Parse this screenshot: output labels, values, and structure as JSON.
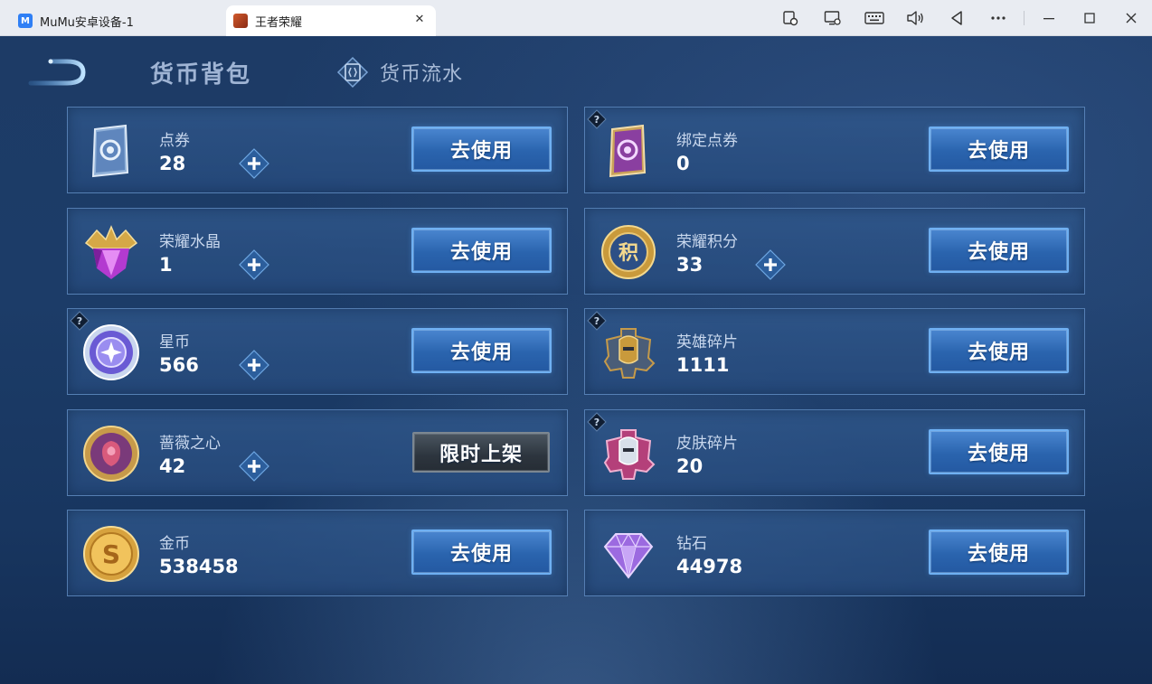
{
  "window": {
    "tabs": [
      {
        "label": "MuMu安卓设备-1",
        "logo": "M"
      },
      {
        "label": "王者荣耀"
      }
    ]
  },
  "toolbar_icons": [
    "settings-monitor-icon",
    "screen-record-icon",
    "keyboard-icon",
    "volume-icon",
    "back-nav-icon",
    "more-icon",
    "minimize-icon",
    "maximize-icon",
    "close-icon"
  ],
  "header": {
    "title": "货币背包",
    "flow_tab": "货币流水"
  },
  "currencies": [
    {
      "name": "点券",
      "value": "28",
      "button": "去使用",
      "add": true,
      "help": false,
      "icon": "voucher-card-icon"
    },
    {
      "name": "绑定点券",
      "value": "0",
      "button": "去使用",
      "add": false,
      "help": true,
      "icon": "bound-voucher-card-icon"
    },
    {
      "name": "荣耀水晶",
      "value": "1",
      "button": "去使用",
      "add": true,
      "help": false,
      "icon": "glory-crystal-icon"
    },
    {
      "name": "荣耀积分",
      "value": "33",
      "button": "去使用",
      "add": true,
      "help": false,
      "icon": "glory-points-icon"
    },
    {
      "name": "星币",
      "value": "566",
      "button": "去使用",
      "add": true,
      "help": true,
      "icon": "star-coin-icon"
    },
    {
      "name": "英雄碎片",
      "value": "1111",
      "button": "去使用",
      "add": false,
      "help": true,
      "icon": "hero-fragment-icon"
    },
    {
      "name": "蔷薇之心",
      "value": "42",
      "button": "限时上架",
      "add": true,
      "help": false,
      "icon": "rose-heart-icon"
    },
    {
      "name": "皮肤碎片",
      "value": "20",
      "button": "去使用",
      "add": false,
      "help": true,
      "icon": "skin-fragment-icon"
    },
    {
      "name": "金币",
      "value": "538458",
      "button": "去使用",
      "add": false,
      "help": false,
      "icon": "gold-coin-icon"
    },
    {
      "name": "钻石",
      "value": "44978",
      "button": "去使用",
      "add": false,
      "help": false,
      "icon": "diamond-icon"
    }
  ],
  "colors": {
    "background": "#1b3a63",
    "button_blue": "#2a64ae",
    "button_border": "#6fb0f2",
    "card_border": "#78a5dc"
  }
}
